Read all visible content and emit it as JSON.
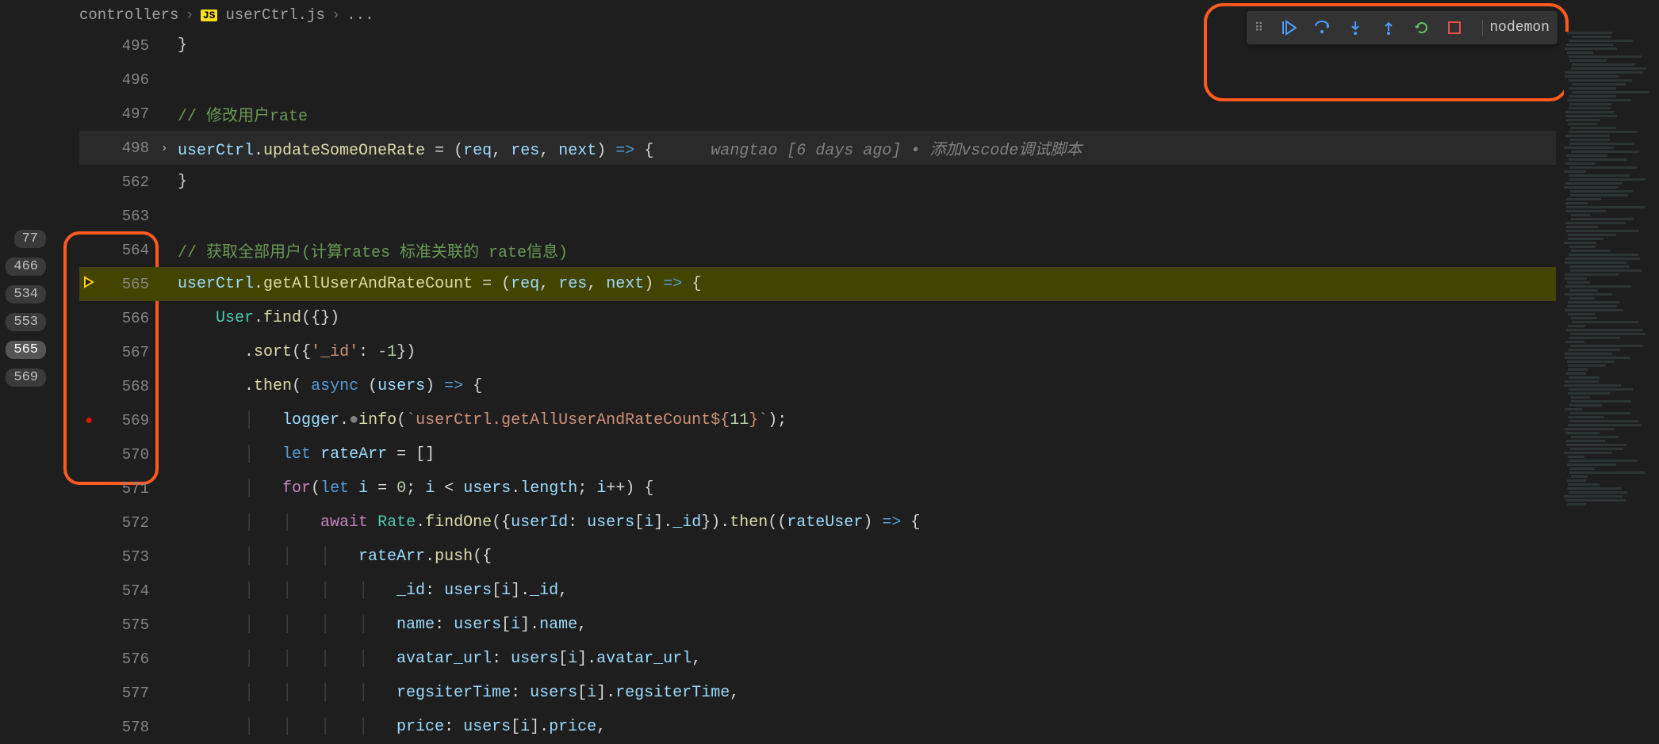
{
  "breadcrumb": {
    "folder": "controllers",
    "file_badge": "JS",
    "file": "userCtrl.js",
    "trailing": "..."
  },
  "debug_toolbar": {
    "continue": "continue",
    "step_over": "step-over",
    "step_into": "step-into",
    "step_out": "step-out",
    "restart": "restart",
    "stop": "stop",
    "config_label": "nodemon"
  },
  "search_markers": [
    "77",
    "466",
    "534",
    "553",
    "565",
    "569"
  ],
  "search_active": "565",
  "lines": [
    {
      "num": "495",
      "glyph": "",
      "fold": "",
      "class": "",
      "html": "}"
    },
    {
      "num": "496",
      "glyph": "",
      "fold": "",
      "class": "",
      "html": ""
    },
    {
      "num": "497",
      "glyph": "",
      "fold": "",
      "class": "",
      "html": "<span class='tok-comment'>// 修改用户rate</span>"
    },
    {
      "num": "498",
      "glyph": "",
      "fold": ">",
      "class": "cursor",
      "html": "<span class='tok-var'>userCtrl</span><span class='tok-punct'>.</span><span class='tok-prop'>updateSomeOneRate</span> <span class='tok-punct'>=</span> <span class='tok-punct'>(</span><span class='tok-var'>req</span><span class='tok-punct'>,</span> <span class='tok-var'>res</span><span class='tok-punct'>,</span> <span class='tok-var'>next</span><span class='tok-punct'>)</span> <span class='tok-keyword'>=&gt;</span> <span class='tok-punct'>{</span>      <span class='tok-inlay'>wangtao [6 days ago] • 添加vscode调试脚本</span>"
    },
    {
      "num": "562",
      "glyph": "",
      "fold": "",
      "class": "",
      "html": "}"
    },
    {
      "num": "563",
      "glyph": "",
      "fold": "",
      "class": "",
      "html": ""
    },
    {
      "num": "564",
      "glyph": "",
      "fold": "",
      "class": "",
      "html": "<span class='tok-comment'>// 获取全部用户(计算rates 标准关联的 rate信息)</span>"
    },
    {
      "num": "565",
      "glyph": "exec",
      "fold": "",
      "class": "exec",
      "html": "<span class='tok-var'>userCtrl</span><span class='tok-punct'>.</span><span class='tok-prop'>getAllUserAndRateCount</span> <span class='tok-punct'>=</span> <span class='tok-punct'>(</span><span class='tok-var'>req</span><span class='tok-punct'>,</span> <span class='tok-var'>res</span><span class='tok-punct'>,</span> <span class='tok-var'>next</span><span class='tok-punct'>)</span> <span class='tok-keyword'>=&gt;</span> <span class='tok-punct'>{</span>"
    },
    {
      "num": "566",
      "glyph": "",
      "fold": "",
      "class": "",
      "html": "    <span class='tok-type'>User</span><span class='tok-punct'>.</span><span class='tok-prop'>find</span><span class='tok-punct'>({})</span>"
    },
    {
      "num": "567",
      "glyph": "",
      "fold": "",
      "class": "",
      "html": "       <span class='tok-punct'>.</span><span class='tok-prop'>sort</span><span class='tok-punct'>({</span><span class='tok-string'>'_id'</span><span class='tok-punct'>:</span> <span class='tok-number'>-1</span><span class='tok-punct'>})</span>"
    },
    {
      "num": "568",
      "glyph": "",
      "fold": "",
      "class": "",
      "html": "       <span class='tok-punct'>.</span><span class='tok-prop'>then</span><span class='tok-punct'>(</span> <span class='tok-keyword'>async</span> <span class='tok-punct'>(</span><span class='tok-var'>users</span><span class='tok-punct'>)</span> <span class='tok-keyword'>=&gt;</span> <span class='tok-punct'>{</span>"
    },
    {
      "num": "569",
      "glyph": "bp",
      "fold": "",
      "class": "",
      "html": "       <span class='indent-guide'>│   </span><span class='tok-var'>logger</span><span class='tok-punct'>.</span><span class='tok-dot'>●</span><span class='tok-prop'>info</span><span class='tok-punct'>(</span><span class='tok-string-tpl'>`userCtrl.getAllUserAndRateCount${</span><span class='tok-number'>11</span><span class='tok-string-tpl'>}`</span><span class='tok-punct'>);</span>"
    },
    {
      "num": "570",
      "glyph": "",
      "fold": "",
      "class": "",
      "html": "       <span class='indent-guide'>│   </span><span class='tok-keyword'>let</span> <span class='tok-var'>rateArr</span> <span class='tok-punct'>=</span> <span class='tok-punct'>[]</span>"
    },
    {
      "num": "571",
      "glyph": "",
      "fold": "",
      "class": "",
      "html": "       <span class='indent-guide'>│   </span><span class='tok-control'>for</span><span class='tok-punct'>(</span><span class='tok-keyword'>let</span> <span class='tok-var'>i</span> <span class='tok-punct'>=</span> <span class='tok-number'>0</span><span class='tok-punct'>;</span> <span class='tok-var'>i</span> <span class='tok-punct'>&lt;</span> <span class='tok-var'>users</span><span class='tok-punct'>.</span><span class='tok-var'>length</span><span class='tok-punct'>;</span> <span class='tok-var'>i</span><span class='tok-punct'>++) {</span>"
    },
    {
      "num": "572",
      "glyph": "",
      "fold": "",
      "class": "",
      "html": "       <span class='indent-guide'>│   │   </span><span class='tok-control'>await</span> <span class='tok-type'>Rate</span><span class='tok-punct'>.</span><span class='tok-prop'>findOne</span><span class='tok-punct'>({</span><span class='tok-var'>userId</span><span class='tok-punct'>:</span> <span class='tok-var'>users</span><span class='tok-punct'>[</span><span class='tok-var'>i</span><span class='tok-punct'>].</span><span class='tok-var'>_id</span><span class='tok-punct'>}).</span><span class='tok-prop'>then</span><span class='tok-punct'>((</span><span class='tok-var'>rateUser</span><span class='tok-punct'>)</span> <span class='tok-keyword'>=&gt;</span> <span class='tok-punct'>{</span>"
    },
    {
      "num": "573",
      "glyph": "",
      "fold": "",
      "class": "",
      "html": "       <span class='indent-guide'>│   │   │   </span><span class='tok-var'>rateArr</span><span class='tok-punct'>.</span><span class='tok-prop'>push</span><span class='tok-punct'>({</span>"
    },
    {
      "num": "574",
      "glyph": "",
      "fold": "",
      "class": "",
      "html": "       <span class='indent-guide'>│   │   │   │   </span><span class='tok-var'>_id</span><span class='tok-punct'>:</span> <span class='tok-var'>users</span><span class='tok-punct'>[</span><span class='tok-var'>i</span><span class='tok-punct'>].</span><span class='tok-var'>_id</span><span class='tok-punct'>,</span>"
    },
    {
      "num": "575",
      "glyph": "",
      "fold": "",
      "class": "",
      "html": "       <span class='indent-guide'>│   │   │   │   </span><span class='tok-var'>name</span><span class='tok-punct'>:</span> <span class='tok-var'>users</span><span class='tok-punct'>[</span><span class='tok-var'>i</span><span class='tok-punct'>].</span><span class='tok-var'>name</span><span class='tok-punct'>,</span>"
    },
    {
      "num": "576",
      "glyph": "",
      "fold": "",
      "class": "",
      "html": "       <span class='indent-guide'>│   │   │   │   </span><span class='tok-var'>avatar_url</span><span class='tok-punct'>:</span> <span class='tok-var'>users</span><span class='tok-punct'>[</span><span class='tok-var'>i</span><span class='tok-punct'>].</span><span class='tok-var'>avatar_url</span><span class='tok-punct'>,</span>"
    },
    {
      "num": "577",
      "glyph": "",
      "fold": "",
      "class": "",
      "html": "       <span class='indent-guide'>│   │   │   │   </span><span class='tok-var'>regsiterTime</span><span class='tok-punct'>:</span> <span class='tok-var'>users</span><span class='tok-punct'>[</span><span class='tok-var'>i</span><span class='tok-punct'>].</span><span class='tok-var'>regsiterTime</span><span class='tok-punct'>,</span>"
    },
    {
      "num": "578",
      "glyph": "",
      "fold": "",
      "class": "",
      "html": "       <span class='indent-guide'>│   │   │   │   </span><span class='tok-var'>price</span><span class='tok-punct'>:</span> <span class='tok-var'>users</span><span class='tok-punct'>[</span><span class='tok-var'>i</span><span class='tok-punct'>].</span><span class='tok-var'>price</span><span class='tok-punct'>,</span>"
    }
  ]
}
